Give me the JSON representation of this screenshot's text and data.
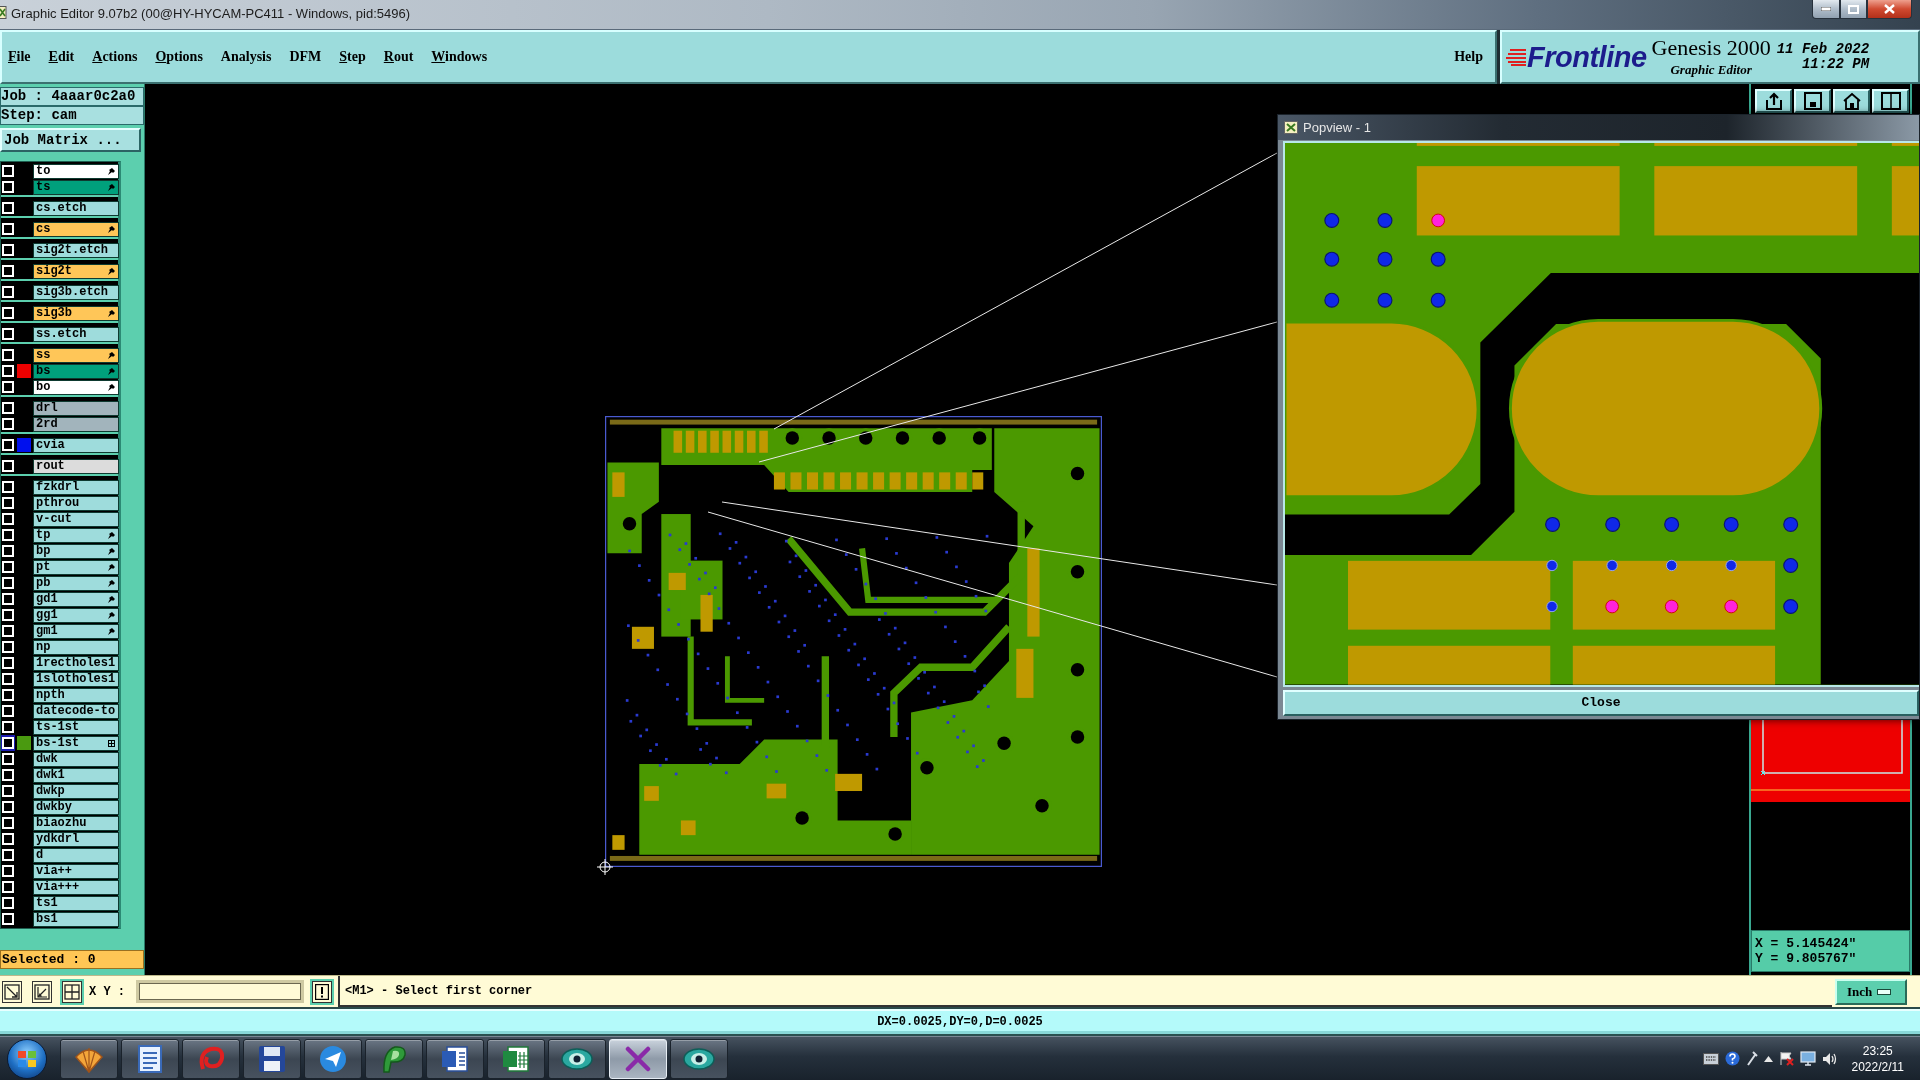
{
  "window": {
    "title": "Graphic Editor 9.07b2 (00@HY-HYCAM-PC411 - Windows, pid:5496)"
  },
  "menu": [
    {
      "label": "File",
      "mnemonic": true
    },
    {
      "label": "Edit",
      "mnemonic": true
    },
    {
      "label": "Actions",
      "mnemonic": true
    },
    {
      "label": "Options",
      "mnemonic": true
    },
    {
      "label": "Analysis",
      "mnemonic": false
    },
    {
      "label": "DFM",
      "mnemonic": false
    },
    {
      "label": "Step",
      "mnemonic": true
    },
    {
      "label": "Rout",
      "mnemonic": true
    },
    {
      "label": "Windows",
      "mnemonic": true
    }
  ],
  "help": "Help",
  "brand": {
    "logo": "Frontline",
    "product": "Genesis 2000",
    "subtitle": "Graphic Editor",
    "date": "11 Feb 2022",
    "time": "11:22 PM"
  },
  "job_panel": {
    "job": "Job : 4aaar0c2a0",
    "step": "Step: cam",
    "matrix_button": "Job Matrix ...",
    "layer_groups": [
      {
        "layers": [
          {
            "name": "to",
            "color": "#ffffff",
            "checked": false,
            "flagged": true,
            "selected": false
          },
          {
            "name": "ts",
            "color": "#00a07c",
            "checked": false,
            "flagged": true,
            "selected": false
          }
        ]
      },
      {
        "layers": [
          {
            "name": "cs.etch",
            "color": "#9edcdc",
            "checked": false,
            "flagged": false,
            "selected": false
          }
        ]
      },
      {
        "layers": [
          {
            "name": "cs",
            "color": "#ffc658",
            "checked": false,
            "flagged": true,
            "selected": false
          }
        ]
      },
      {
        "layers": [
          {
            "name": "sig2t.etch",
            "color": "#9edcdc",
            "checked": false,
            "flagged": false,
            "selected": false
          }
        ]
      },
      {
        "layers": [
          {
            "name": "sig2t",
            "color": "#ffc658",
            "checked": false,
            "flagged": true,
            "selected": false
          }
        ]
      },
      {
        "layers": [
          {
            "name": "sig3b.etch",
            "color": "#9edcdc",
            "checked": false,
            "flagged": false,
            "selected": false
          }
        ]
      },
      {
        "layers": [
          {
            "name": "sig3b",
            "color": "#ffc658",
            "checked": false,
            "flagged": true,
            "selected": false
          }
        ]
      },
      {
        "layers": [
          {
            "name": "ss.etch",
            "color": "#9edcdc",
            "checked": false,
            "flagged": false,
            "selected": false
          }
        ]
      },
      {
        "layers": [
          {
            "name": "ss",
            "color": "#ffc658",
            "checked": false,
            "flagged": true,
            "selected": false
          },
          {
            "name": "bs",
            "color": "#00a07c",
            "checked": false,
            "flagged": true,
            "selected": false,
            "swatch": {
              "color": "#ee0000"
            }
          },
          {
            "name": "bo",
            "color": "#ffffff",
            "checked": false,
            "flagged": true,
            "selected": false
          }
        ]
      },
      {
        "layers": [
          {
            "name": "drl",
            "color": "#a2b4bc",
            "checked": false,
            "flagged": false,
            "selected": false
          },
          {
            "name": "2rd",
            "color": "#a2b4bc",
            "checked": false,
            "flagged": false,
            "selected": false
          }
        ]
      },
      {
        "layers": [
          {
            "name": "cvia",
            "color": "#9edcdc",
            "checked": false,
            "flagged": false,
            "selected": false,
            "swatch": {
              "color": "#0010ee"
            }
          }
        ]
      },
      {
        "layers": [
          {
            "name": "rout",
            "color": "#dcdcdc",
            "checked": false,
            "flagged": false,
            "selected": false
          }
        ]
      },
      {
        "layers": [
          {
            "name": "fzkdrl",
            "color": "#9edcdc",
            "checked": false,
            "flagged": false,
            "selected": false
          },
          {
            "name": "pthrou",
            "color": "#9edcdc",
            "checked": false,
            "flagged": false,
            "selected": false
          },
          {
            "name": "v-cut",
            "color": "#9edcdc",
            "checked": false,
            "flagged": false,
            "selected": false
          },
          {
            "name": "tp",
            "color": "#9edcdc",
            "checked": false,
            "flagged": true,
            "selected": false
          },
          {
            "name": "bp",
            "color": "#9edcdc",
            "checked": false,
            "flagged": true,
            "selected": false
          },
          {
            "name": "pt",
            "color": "#9edcdc",
            "checked": false,
            "flagged": true,
            "selected": false
          },
          {
            "name": "pb",
            "color": "#9edcdc",
            "checked": false,
            "flagged": true,
            "selected": false
          },
          {
            "name": "gd1",
            "color": "#9edcdc",
            "checked": false,
            "flagged": true,
            "selected": false
          },
          {
            "name": "gg1",
            "color": "#9edcdc",
            "checked": false,
            "flagged": true,
            "selected": false
          },
          {
            "name": "gm1",
            "color": "#9edcdc",
            "checked": false,
            "flagged": true,
            "selected": false
          },
          {
            "name": "np",
            "color": "#9edcdc",
            "checked": false,
            "flagged": false,
            "selected": false
          },
          {
            "name": "1rectholes1",
            "color": "#9edcdc",
            "checked": false,
            "flagged": false,
            "selected": false
          },
          {
            "name": "1slotholes1",
            "color": "#9edcdc",
            "checked": false,
            "flagged": false,
            "selected": false
          },
          {
            "name": "npth",
            "color": "#9edcdc",
            "checked": false,
            "flagged": false,
            "selected": false
          },
          {
            "name": "datecode-to",
            "color": "#9edcdc",
            "checked": false,
            "flagged": false,
            "selected": false
          },
          {
            "name": "ts-1st",
            "color": "#9edcdc",
            "checked": false,
            "flagged": false,
            "selected": false
          },
          {
            "name": "bs-1st",
            "color": "#9edcdc",
            "checked": false,
            "flagged": false,
            "selected": true,
            "swatch": {
              "color": "#4a9a10"
            }
          },
          {
            "name": "dwk",
            "color": "#9edcdc",
            "checked": false,
            "flagged": false,
            "selected": false
          },
          {
            "name": "dwk1",
            "color": "#9edcdc",
            "checked": false,
            "flagged": false,
            "selected": false
          },
          {
            "name": "dwkp",
            "color": "#9edcdc",
            "checked": false,
            "flagged": false,
            "selected": false
          },
          {
            "name": "dwkby",
            "color": "#9edcdc",
            "checked": false,
            "flagged": false,
            "selected": false
          },
          {
            "name": "biaozhu",
            "color": "#9edcdc",
            "checked": false,
            "flagged": false,
            "selected": false
          },
          {
            "name": "ydkdrl",
            "color": "#9edcdc",
            "checked": false,
            "flagged": false,
            "selected": false
          },
          {
            "name": "d",
            "color": "#9edcdc",
            "checked": false,
            "flagged": false,
            "selected": false
          },
          {
            "name": "via++",
            "color": "#9edcdc",
            "checked": false,
            "flagged": false,
            "selected": false
          },
          {
            "name": "via+++",
            "color": "#9edcdc",
            "checked": false,
            "flagged": false,
            "selected": false
          },
          {
            "name": "ts1",
            "color": "#9edcdc",
            "checked": false,
            "flagged": false,
            "selected": false
          },
          {
            "name": "bs1",
            "color": "#9edcdc",
            "checked": false,
            "flagged": false,
            "selected": false
          }
        ]
      }
    ],
    "selected": "Selected : 0"
  },
  "popview": {
    "title": "Popview - 1",
    "close_button": "Close"
  },
  "coordinates": {
    "x": "X = 5.145424\"",
    "y": "Y = 9.805767\""
  },
  "command_bar": {
    "tools": [
      {
        "on": false
      },
      {
        "on": false
      },
      {
        "on": true
      }
    ],
    "xy_label": "X Y :",
    "prompt": "<M1> - Select first corner",
    "units": "Inch"
  },
  "status_bar": "DX=0.0025,DY=0,D=0.0025",
  "taskbar": {
    "apps": [
      {
        "running": true,
        "active": false
      },
      {
        "running": true,
        "active": false
      },
      {
        "running": true,
        "active": false
      },
      {
        "running": true,
        "active": false
      },
      {
        "running": true,
        "active": false
      },
      {
        "running": true,
        "active": false
      },
      {
        "running": true,
        "active": false
      },
      {
        "running": true,
        "active": false
      },
      {
        "running": true,
        "active": false
      },
      {
        "running": true,
        "active": true
      },
      {
        "running": true,
        "active": false
      }
    ],
    "time": "23:25",
    "date": "2022/2/11"
  }
}
